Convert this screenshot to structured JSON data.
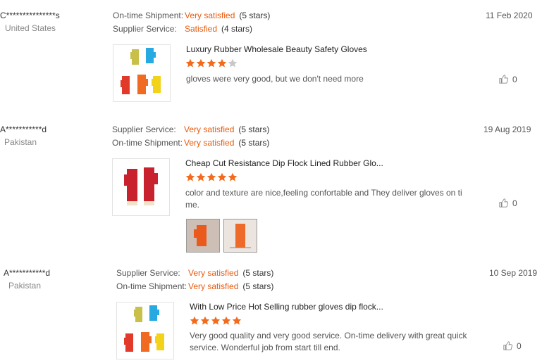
{
  "reviews": [
    {
      "user": "C***************s",
      "country": "United States",
      "date": "11 Feb 2020",
      "ratings": [
        {
          "label": "On-time Shipment:",
          "value": "Very satisfied",
          "stars": "(5 stars)"
        },
        {
          "label": "Supplier Service:",
          "value": "Satisfied",
          "stars": "(4 stars)"
        }
      ],
      "product_title": "Luxury Rubber Wholesale Beauty Safety Gloves",
      "star_rating": 4,
      "comment": "gloves were very good, but we don't need more",
      "likes": "0",
      "thumbnail": "five-colored-gloves"
    },
    {
      "user": "A***********d",
      "country": "Pakistan",
      "date": "19 Aug 2019",
      "ratings": [
        {
          "label": "Supplier Service:",
          "value": "Very satisfied",
          "stars": "(5 stars)"
        },
        {
          "label": "On-time Shipment:",
          "value": "Very satisfied",
          "stars": "(5 stars)"
        }
      ],
      "product_title": "Cheap Cut Resistance Dip Flock Lined Rubber Glo...",
      "star_rating": 5,
      "comment": "color and texture are nice,feeling confortable and They deliver gloves on time.",
      "likes": "0",
      "thumbnail": "red-gloves-pair"
    },
    {
      "user": "A***********d",
      "country": "Pakistan",
      "date": "10 Sep 2019",
      "ratings": [
        {
          "label": "Supplier Service:",
          "value": "Very satisfied",
          "stars": "(5 stars)"
        },
        {
          "label": "On-time Shipment:",
          "value": "Very satisfied",
          "stars": "(5 stars)"
        }
      ],
      "product_title": "With Low Price Hot Selling rubber gloves dip flock...",
      "star_rating": 5,
      "comment": "Very good quality and very good service. On-time delivery with great quick service. Wonderful job from start till end.",
      "likes": "0",
      "thumbnail": "five-colored-gloves"
    }
  ],
  "colors": {
    "accent": "#e8590c",
    "star_on": "#f26b1d",
    "star_off": "#c8c8c8"
  }
}
